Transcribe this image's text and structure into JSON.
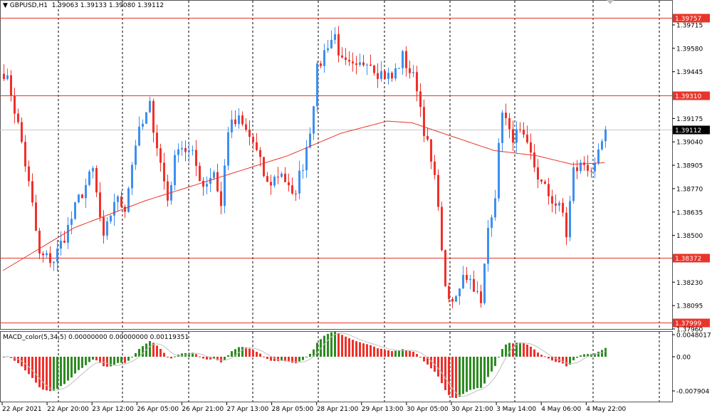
{
  "header": {
    "symbol": "GBPUSD,H1",
    "ohlc": "1.39063 1.39133 1.39080 1.39112"
  },
  "macd": {
    "label": "MACD_color(5,34,5) 0.00000000 0.00000000 0.00119351",
    "axis": [
      "0.0048017",
      "0.00",
      "-0.007904"
    ]
  },
  "colors": {
    "bull": "#3d8ff0",
    "bear": "#f0302a",
    "ma": "#e8342a",
    "hline": "#e8342a",
    "current": "#c8c8c8",
    "macd_up": "#2e8b22",
    "macd_down": "#f0302a",
    "signal": "#c0c0c0"
  },
  "chart_data": {
    "type": "candlestick",
    "price_range": [
      1.3796,
      1.3974
    ],
    "price_ticks": [
      "1.39715",
      "1.39580",
      "1.39445",
      "1.39175",
      "1.39040",
      "1.38905",
      "1.38770",
      "1.38635",
      "1.38500",
      "1.38230",
      "1.38095",
      "1.37960"
    ],
    "hlines": [
      "1.39757",
      "1.39310",
      "1.38372",
      "1.37999"
    ],
    "current_price": "1.39112",
    "time_labels": [
      "22 Apr 2021",
      "22 Apr 20:00",
      "23 Apr 12:00",
      "26 Apr 05:00",
      "26 Apr 21:00",
      "27 Apr 13:00",
      "28 Apr 05:00",
      "28 Apr 21:00",
      "29 Apr 13:00",
      "30 Apr 05:00",
      "30 Apr 21:00",
      "3 May 14:00",
      "4 May 06:00",
      "4 May 22:00"
    ],
    "close_waypoints": [
      [
        0,
        1.39448
      ],
      [
        2,
        1.39325
      ],
      [
        5,
        1.39037
      ],
      [
        8,
        1.38667
      ],
      [
        10,
        1.38379
      ],
      [
        14,
        1.38359
      ],
      [
        18,
        1.38544
      ],
      [
        21,
        1.38708
      ],
      [
        25,
        1.38872
      ],
      [
        28,
        1.38462
      ],
      [
        31,
        1.38708
      ],
      [
        34,
        1.38667
      ],
      [
        37,
        1.39037
      ],
      [
        41,
        1.39242
      ],
      [
        44,
        1.38914
      ],
      [
        46,
        1.38708
      ],
      [
        49,
        1.39037
      ],
      [
        53,
        1.38955
      ],
      [
        56,
        1.3879
      ],
      [
        59,
        1.38872
      ],
      [
        61,
        1.38667
      ],
      [
        63,
        1.39119
      ],
      [
        66,
        1.3916
      ],
      [
        70,
        1.39037
      ],
      [
        74,
        1.3879
      ],
      [
        78,
        1.38872
      ],
      [
        81,
        1.38708
      ],
      [
        84,
        1.38914
      ],
      [
        86,
        1.39119
      ],
      [
        88,
        1.39448
      ],
      [
        91,
        1.39612
      ],
      [
        93,
        1.39653
      ],
      [
        95,
        1.39489
      ],
      [
        99,
        1.39448
      ],
      [
        102,
        1.3953
      ],
      [
        105,
        1.39448
      ],
      [
        109,
        1.39407
      ],
      [
        112,
        1.3953
      ],
      [
        116,
        1.39366
      ],
      [
        118,
        1.39119
      ],
      [
        120,
        1.38914
      ],
      [
        122,
        1.38708
      ],
      [
        123,
        1.38379
      ],
      [
        125,
        1.38091
      ],
      [
        127,
        1.38133
      ],
      [
        129,
        1.38297
      ],
      [
        132,
        1.38215
      ],
      [
        134,
        1.38091
      ],
      [
        136,
        1.38544
      ],
      [
        138,
        1.38749
      ],
      [
        140,
        1.39242
      ],
      [
        142,
        1.39078
      ],
      [
        145,
        1.39078
      ],
      [
        148,
        1.38955
      ],
      [
        151,
        1.3879
      ],
      [
        154,
        1.38708
      ],
      [
        157,
        1.38626
      ],
      [
        158,
        1.38503
      ],
      [
        160,
        1.38872
      ],
      [
        163,
        1.38914
      ],
      [
        166,
        1.38872
      ],
      [
        169,
        1.39112
      ]
    ],
    "ma_waypoints": [
      [
        0,
        1.38297
      ],
      [
        20,
        1.38544
      ],
      [
        40,
        1.387
      ],
      [
        60,
        1.3883
      ],
      [
        80,
        1.3896
      ],
      [
        95,
        1.3909
      ],
      [
        108,
        1.3916
      ],
      [
        115,
        1.3915
      ],
      [
        125,
        1.3908
      ],
      [
        138,
        1.3899
      ],
      [
        150,
        1.3896
      ],
      [
        160,
        1.3891
      ],
      [
        169,
        1.3892
      ]
    ]
  }
}
